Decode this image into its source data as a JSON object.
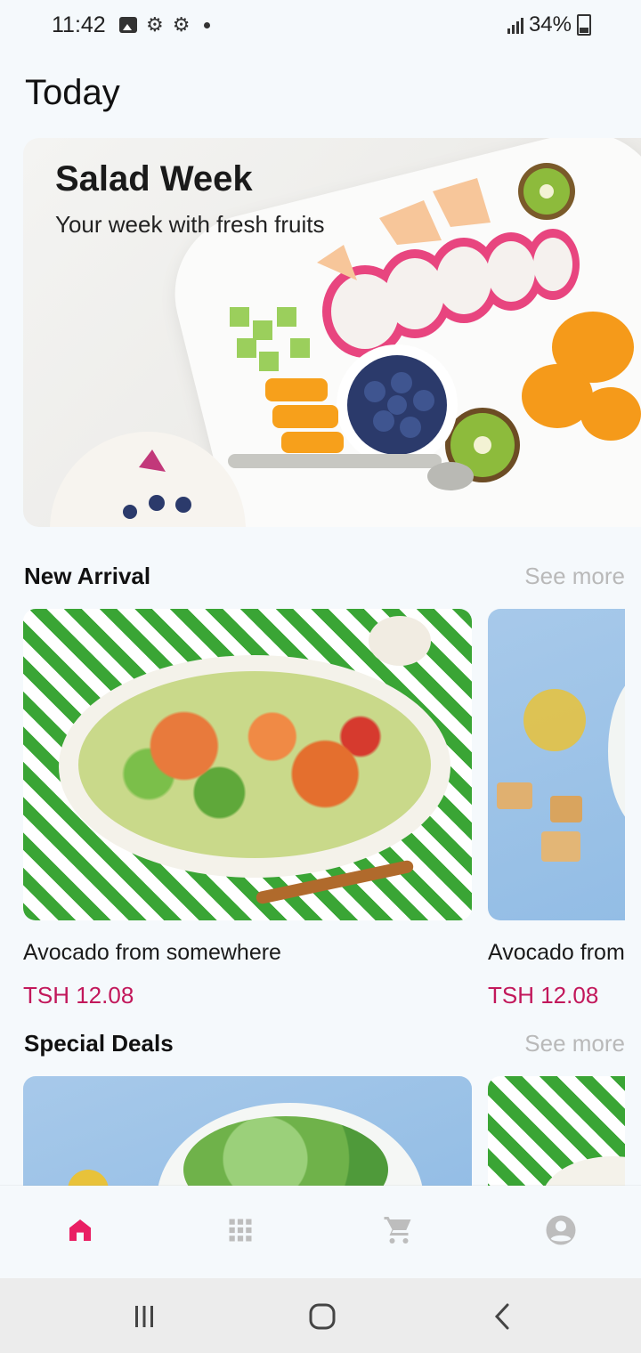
{
  "status_bar": {
    "time": "11:42",
    "battery": "34%",
    "icons": [
      "image-icon",
      "settings-icon",
      "settings-icon",
      "dot-icon",
      "signal-icon",
      "battery-charging-icon"
    ]
  },
  "page_title": "Today",
  "hero": {
    "title": "Salad Week",
    "subtitle": "Your week with fresh fruits"
  },
  "new_arrival": {
    "title": "New Arrival",
    "see_more": "See more",
    "items": [
      {
        "name": "Avocado from somewhere",
        "price": "TSH 12.08"
      },
      {
        "name": "Avocado from somewhere",
        "price": "TSH 12.08"
      }
    ]
  },
  "special_deals": {
    "title": "Special Deals",
    "see_more": "See more"
  },
  "bottom_nav": {
    "items": [
      "home-icon",
      "grid-icon",
      "cart-icon",
      "profile-icon"
    ],
    "active": "home-icon",
    "active_color": "#E91E63",
    "inactive_color": "#BDBDBD"
  },
  "system_nav": [
    "recents-icon",
    "home-button-icon",
    "back-icon"
  ],
  "colors": {
    "background": "#F5F9FC",
    "price": "#C2185B",
    "see_more": "#B9B9B9"
  }
}
